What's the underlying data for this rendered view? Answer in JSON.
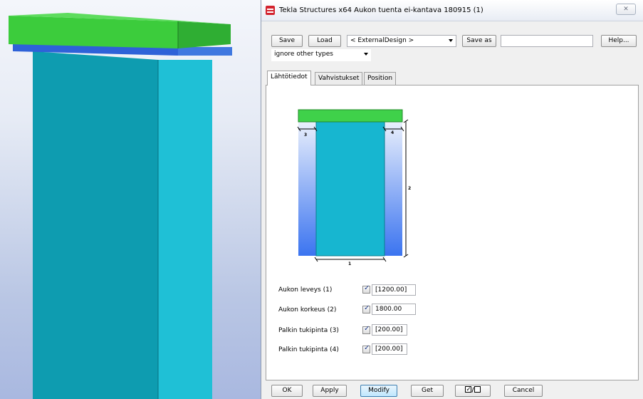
{
  "window": {
    "title": "Tekla Structures x64  Aukon tuenta ei-kantava 180915 (1)",
    "close_glyph": "✕",
    "icon": "tekla-logo-icon"
  },
  "toolbar": {
    "save_label": "Save",
    "load_label": "Load",
    "preset_value": "< ExternalDesign >",
    "save_as_label": "Save as",
    "save_as_value": "",
    "help_label": "Help...",
    "filter_value": "ignore other types"
  },
  "tabs": [
    {
      "label": "Lähtötiedot",
      "active": true
    },
    {
      "label": "Vahvistukset",
      "active": false
    },
    {
      "label": "Position",
      "active": false
    }
  ],
  "diagram": {
    "dim_labels": [
      "1",
      "2",
      "3",
      "4"
    ],
    "colors": {
      "beam": "#3fd14a",
      "opening": "#17b6d0",
      "support_top": "#e8eefb",
      "support_bottom": "#3b74f0"
    }
  },
  "params": [
    {
      "label": "Aukon leveys (1)",
      "checked": true,
      "value": "[1200.00]"
    },
    {
      "label": "Aukon korkeus (2)",
      "checked": true,
      "value": "1800.00"
    },
    {
      "label": "Palkin tukipinta (3)",
      "checked": true,
      "value": "[200.00]"
    },
    {
      "label": "Palkin tukipinta (4)",
      "checked": true,
      "value": "[200.00]"
    }
  ],
  "footer": {
    "ok_label": "OK",
    "apply_label": "Apply",
    "modify_label": "Modify",
    "get_label": "Get",
    "toggle_separator": "/",
    "cancel_label": "Cancel"
  },
  "model_colors": {
    "beam_top": "#3ccc3c",
    "beam_under": "#2a5fd6",
    "wall_front": "#0f9eb1",
    "wall_side": "#22c3d8"
  }
}
